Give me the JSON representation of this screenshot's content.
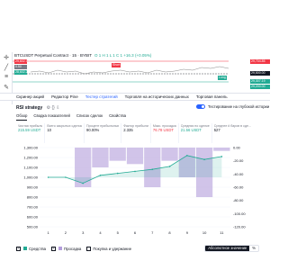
{
  "chart": {
    "title": "BTCUSDT Perpetual Contract · 15 · BYBIT",
    "ohlc": "O 1 H 1 L 1 C 1 +16.3 (+0.05%)",
    "symbol_chips": [
      "29,602.75",
      "0.50",
      "28,602.25"
    ],
    "tags": [
      "Short",
      "Long"
    ],
    "price_tags": [
      {
        "text": "29,704.85",
        "color": "#f23645"
      },
      {
        "text": "29,500.00",
        "color": "#131722"
      },
      {
        "text": "29,307.19",
        "color": "#22ab94"
      },
      {
        "text": "29,200.00",
        "color": "#22ab94"
      }
    ],
    "time_ticks": [
      "",
      "",
      "",
      "",
      "",
      ""
    ]
  },
  "bottom_tabs": [
    {
      "label": "Скринер акций",
      "active": false
    },
    {
      "label": "Редактор Pine",
      "active": false
    },
    {
      "label": "Тестер стратегий",
      "active": true
    },
    {
      "label": "Торговля на исторических данных",
      "active": false
    },
    {
      "label": "Торговая панель",
      "active": false
    }
  ],
  "panel": {
    "strategy_name": "RSI strategy",
    "deep_backtest_label": "Тестирование на глубокой истории",
    "subtabs": [
      {
        "label": "Обзор",
        "active": true
      },
      {
        "label": "Сводка показателей",
        "active": false
      },
      {
        "label": "Список сделок",
        "active": false
      },
      {
        "label": "Свойства",
        "active": false
      }
    ],
    "metrics": [
      {
        "label": "Чистая прибыль",
        "value": "215.59 USDT",
        "sign": "pos"
      },
      {
        "label": "Всего закрытых сделок",
        "value": "10",
        "sign": ""
      },
      {
        "label": "Процент прибыльных",
        "value": "90.00%",
        "sign": ""
      },
      {
        "label": "Фактор прибыли",
        "value": "2.335",
        "sign": ""
      },
      {
        "label": "Макс. просадка",
        "value": "76.78 USDT",
        "sign": "neg"
      },
      {
        "label": "Средняя по сделке",
        "value": "21.56 USDT",
        "sign": "pos"
      },
      {
        "label": "Среднее # баров в сде...",
        "value": "527",
        "sign": ""
      }
    ],
    "legend": {
      "equity": "Средства",
      "drawdown": "Просадка",
      "buy_hold": "Покупка и удержание",
      "absolute": "Абсолютное значение",
      "percent": "%"
    }
  },
  "chart_data": [
    {
      "type": "area",
      "x": [
        1,
        2,
        3,
        4,
        5,
        6,
        7,
        8,
        9,
        10,
        11
      ],
      "y_left_ticks": [
        "1,300.00",
        "1,200.00",
        "1,100.00",
        "1,000.00",
        "900.00",
        "800.00",
        "700.00",
        "600.00",
        "500.00"
      ],
      "y_right_ticks": [
        "0.00",
        "-20.00",
        "-40.00",
        "-60.00",
        "-80.00",
        "-100.00",
        "-120.00"
      ],
      "series": [
        {
          "name": "Средства",
          "values": [
            1000,
            1000,
            940,
            1020,
            1040,
            1060,
            1080,
            1110,
            1220,
            1180,
            1210
          ],
          "color": "#22ab94"
        },
        {
          "name": "Просадка",
          "values": [
            0,
            0,
            -60,
            -30,
            -20,
            -25,
            -60,
            -20,
            -45,
            -75,
            -5
          ],
          "color": "#b39ddb"
        }
      ]
    }
  ]
}
